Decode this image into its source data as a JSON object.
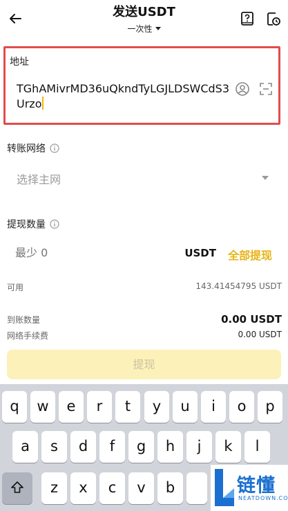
{
  "header": {
    "title": "发送USDT",
    "subtitle": "一次性"
  },
  "address": {
    "label": "地址",
    "value": "TGhAMivrMD36uQkndTyLGJLDSWCdS3Urzo"
  },
  "network": {
    "label": "转账网络",
    "placeholder": "选择主网"
  },
  "amount": {
    "label": "提现数量",
    "placeholder": "最少 0",
    "unit": "USDT",
    "max_label": "全部提现"
  },
  "available": {
    "label": "可用",
    "value": "143.41454795 USDT"
  },
  "receive": {
    "label": "到账数量",
    "value": "0.00 USDT"
  },
  "fee": {
    "label": "网络手续费",
    "value": "0.00 USDT"
  },
  "submit_label": "提现",
  "keyboard": {
    "row1": [
      "q",
      "w",
      "e",
      "r",
      "t",
      "y",
      "u",
      "i",
      "o",
      "p"
    ],
    "row2": [
      "a",
      "s",
      "d",
      "f",
      "g",
      "h",
      "j",
      "k",
      "l"
    ],
    "row3": [
      "z",
      "x",
      "c",
      "v",
      "b"
    ]
  },
  "brand": {
    "name": "链懂",
    "sub": "NEATDOWN.COM"
  },
  "colors": {
    "accent": "#e7b416",
    "highlight_border": "#e24c4c",
    "submit_bg": "#fcf1b8"
  }
}
